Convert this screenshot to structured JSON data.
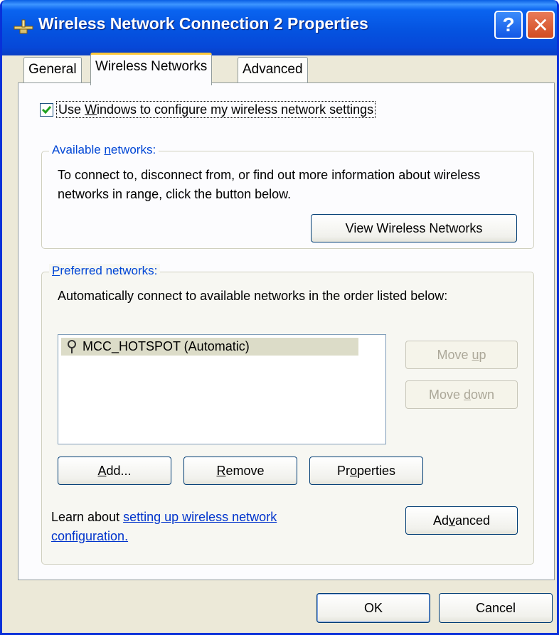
{
  "window": {
    "title": "Wireless Network Connection 2 Properties",
    "help_label": "?",
    "close_label": "✕"
  },
  "tabs": [
    {
      "label": "General"
    },
    {
      "label": "Wireless Networks",
      "active": true
    },
    {
      "label": "Advanced"
    }
  ],
  "use_windows": {
    "checked": true,
    "label_pre": "Use ",
    "label_u": "W",
    "label_post": "indows to configure my wireless network settings"
  },
  "available": {
    "title_pre": "Available ",
    "title_u": "n",
    "title_post": "etworks:",
    "description": "To connect to, disconnect from, or find out more information about wireless networks in range, click the button below.",
    "view_button": "View Wireless Networks"
  },
  "preferred": {
    "title_u": "P",
    "title_post": "referred networks:",
    "description": "Automatically connect to available networks in the order listed below:",
    "networks": [
      {
        "label": "MCC_HOTSPOT (Automatic)"
      }
    ],
    "move_up": {
      "pre": "Move ",
      "u": "u",
      "post": "p"
    },
    "move_down": {
      "pre": "Move ",
      "u": "d",
      "post": "own"
    },
    "add": {
      "u": "A",
      "post": "dd..."
    },
    "remove": {
      "u": "R",
      "post": "emove"
    },
    "properties": {
      "pre": "Pr",
      "u": "o",
      "post": "perties"
    },
    "learn_pre": "Learn about ",
    "learn_link": "setting up wireless network configuration.",
    "advanced": {
      "pre": "Ad",
      "u": "v",
      "post": "anced"
    }
  },
  "footer": {
    "ok": "OK",
    "cancel": "Cancel"
  }
}
